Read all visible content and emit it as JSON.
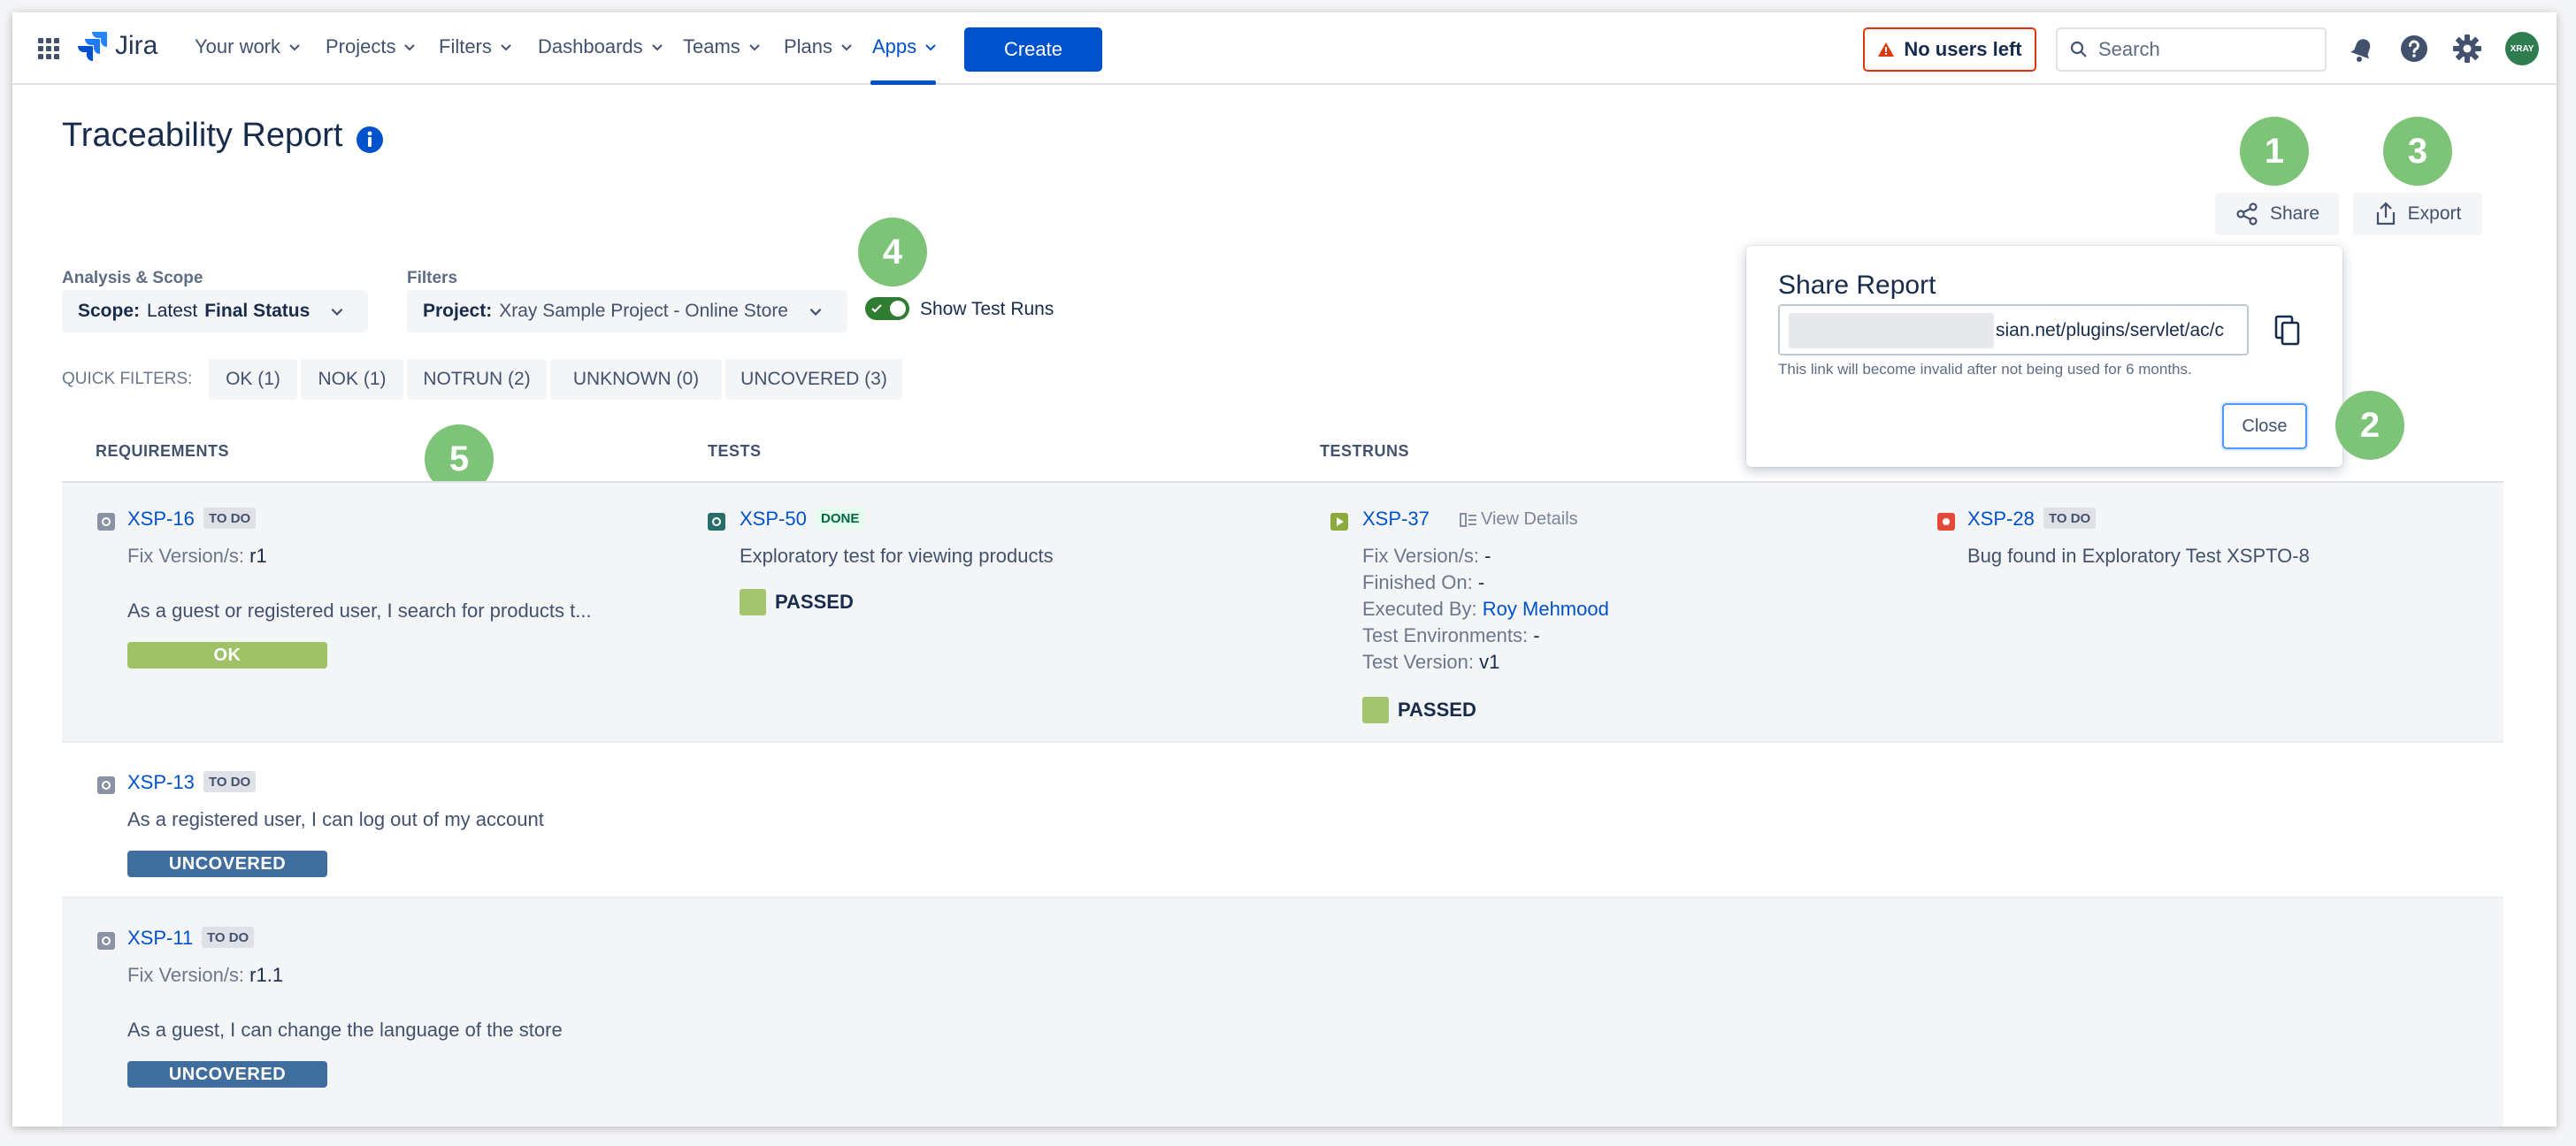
{
  "nav": {
    "logo_text": "Jira",
    "items": [
      {
        "label": "Your work"
      },
      {
        "label": "Projects"
      },
      {
        "label": "Filters"
      },
      {
        "label": "Dashboards"
      },
      {
        "label": "Teams"
      },
      {
        "label": "Plans"
      },
      {
        "label": "Apps"
      }
    ],
    "create_label": "Create",
    "no_users_label": "No users left",
    "search_placeholder": "Search",
    "avatar_text": "XRAY"
  },
  "page": {
    "title": "Traceability Report",
    "share_label": "Share",
    "export_label": "Export",
    "analysis_label": "Analysis & Scope",
    "scope_prefix": "Scope:",
    "scope_value": "Latest",
    "scope_bold": "Final Status",
    "filters_label": "Filters",
    "project_prefix": "Project:",
    "project_value": "Xray Sample Project - Online Store",
    "show_test_runs": "Show Test Runs",
    "quick_filters_label": "QUICK FILTERS:",
    "quick_filters": [
      "OK (1)",
      "NOK (1)",
      "NOTRUN (2)",
      "UNKNOWN (0)",
      "UNCOVERED (3)"
    ],
    "columns": [
      "REQUIREMENTS",
      "TESTS",
      "TESTRUNS"
    ]
  },
  "rows": [
    {
      "req": {
        "key": "XSP-16",
        "status": "TO DO",
        "fix_label": "Fix Version/s:",
        "fix_value": "r1",
        "summary": "As a guest or registered user, I search for products t...",
        "coverage": "OK"
      },
      "test": {
        "key": "XSP-50",
        "status": "DONE",
        "summary": "Exploratory test for viewing products",
        "result": "PASSED"
      },
      "run": {
        "key": "XSP-37",
        "view_details": "View Details",
        "fix_label": "Fix Version/s:",
        "fix_value": "-",
        "finished_label": "Finished On:",
        "finished_value": "-",
        "executed_label": "Executed By:",
        "executed_value": "Roy Mehmood",
        "env_label": "Test Environments:",
        "env_value": "-",
        "version_label": "Test Version:",
        "version_value": "v1",
        "result": "PASSED"
      },
      "bug": {
        "key": "XSP-28",
        "status": "TO DO",
        "summary": "Bug found in Exploratory Test XSPTO-8"
      }
    },
    {
      "req": {
        "key": "XSP-13",
        "status": "TO DO",
        "summary": "As a registered user, I can log out of my account",
        "coverage": "UNCOVERED"
      }
    },
    {
      "req": {
        "key": "XSP-11",
        "status": "TO DO",
        "fix_label": "Fix Version/s:",
        "fix_value": "r1.1",
        "summary": "As a guest, I can change the language of the store",
        "coverage": "UNCOVERED"
      }
    }
  ],
  "share_popup": {
    "title": "Share Report",
    "url_visible": "sian.net/plugins/servlet/ac/c",
    "note": "This link will become invalid after not being used for 6 months.",
    "close_label": "Close"
  },
  "callouts": [
    "1",
    "2",
    "3",
    "4",
    "5"
  ],
  "colors": {
    "primary": "#0052cc",
    "ok": "#9ec265",
    "uncovered": "#3f6e9e",
    "passed": "#a2c56e",
    "callout": "#7dc478",
    "toggle": "#2e7d32",
    "warning": "#de350b"
  }
}
